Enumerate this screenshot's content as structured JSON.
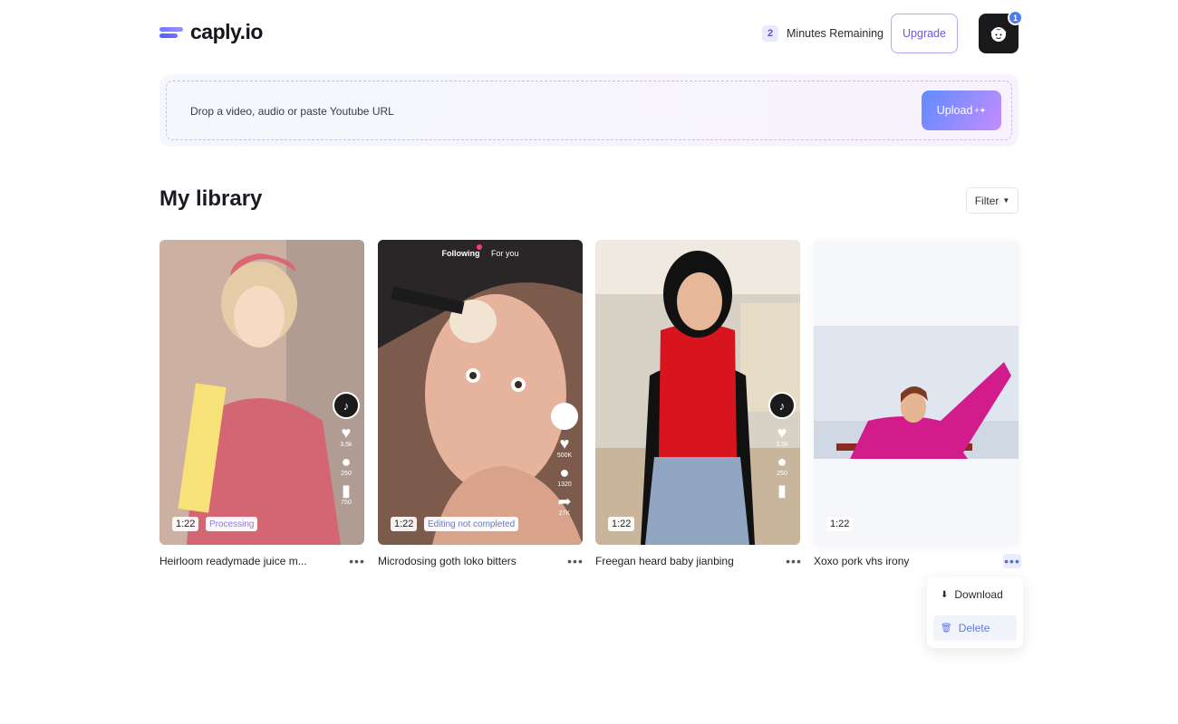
{
  "header": {
    "logo_text": "caply.io",
    "minutes_count": "2",
    "minutes_label": "Minutes Remaining",
    "upgrade_label": "Upgrade",
    "notification_count": "1"
  },
  "dropzone": {
    "prompt": "Drop a video, audio or paste Youtube URL",
    "upload_label": "Upload",
    "upload_sparkle": "+✦"
  },
  "library": {
    "title": "My library",
    "filter_label": "Filter",
    "cards": [
      {
        "title": "Heirloom readymade juice m...",
        "duration": "1:22",
        "status": "Processing",
        "stats": [
          "3.5k",
          "250",
          "750"
        ]
      },
      {
        "title": "Microdosing goth loko bitters",
        "duration": "1:22",
        "status": "Editing not completed",
        "stats": [
          "500K",
          "1320",
          "27K"
        ],
        "feed_tabs": [
          "Following",
          "For you"
        ]
      },
      {
        "title": "Freegan heard baby jianbing",
        "duration": "1:22",
        "status": "",
        "stats": [
          "3.5k",
          "250",
          ""
        ]
      },
      {
        "title": "Xoxo pork vhs irony",
        "duration": "1:22",
        "status": ""
      }
    ]
  },
  "menu": {
    "download_label": "Download",
    "delete_label": "Delete"
  },
  "colors": {
    "accent": "#6a5ae0",
    "upload_gradient_start": "#5f8cff",
    "upload_gradient_end": "#c48cff"
  }
}
